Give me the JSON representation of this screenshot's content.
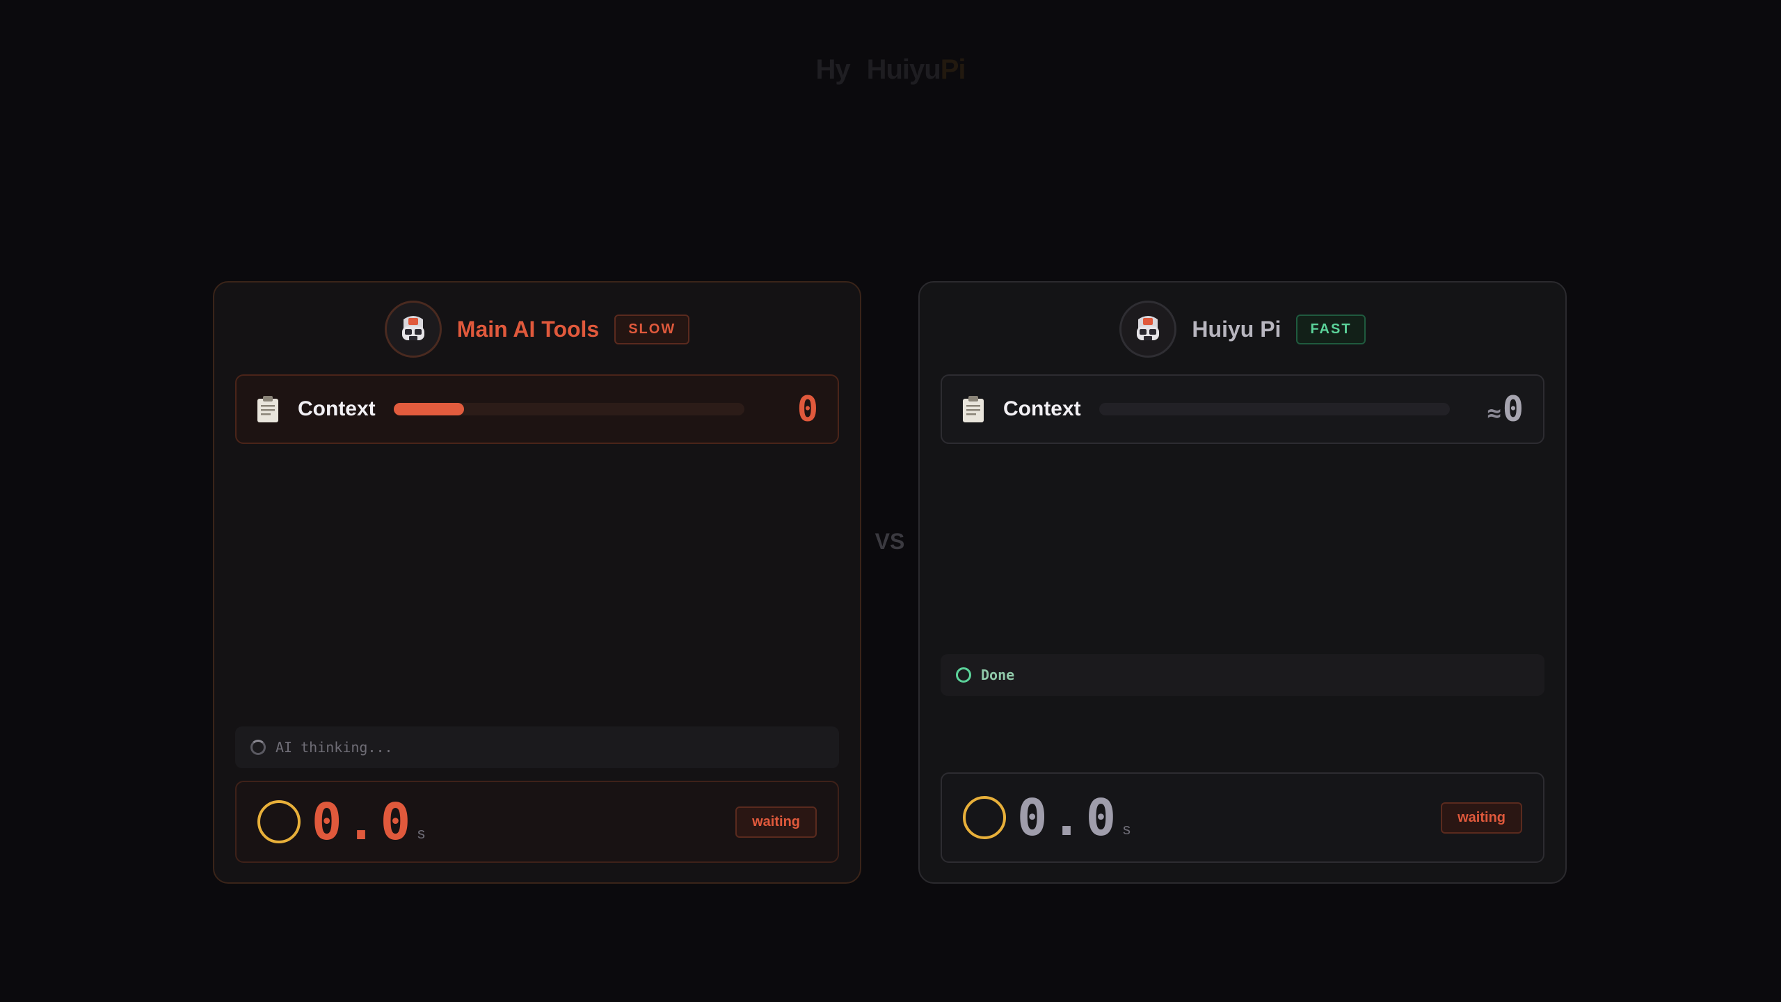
{
  "brand": {
    "mark": "Hy",
    "name_part1": "Huiyu",
    "name_part2": "Pi"
  },
  "vs_label": "VS",
  "left_panel": {
    "title": "Main AI Tools",
    "badge": "SLOW",
    "context_label": "Context",
    "context_progress": 0.2,
    "context_value": "0",
    "status_text": "AI thinking...",
    "timer_value": "0.0",
    "timer_unit": "s",
    "timer_badge": "waiting"
  },
  "right_panel": {
    "title": "Huiyu Pi",
    "badge": "FAST",
    "context_label": "Context",
    "context_progress": 0,
    "context_prefix": "≈",
    "context_value": "0",
    "status_text": "Done",
    "timer_value": "0.0",
    "timer_unit": "s",
    "timer_badge": "waiting"
  },
  "colors": {
    "accent_slow": "#e0593c",
    "accent_fast": "#5bd39a",
    "timer_ring": "#e8b03a",
    "background": "#0b0a0d"
  },
  "icons": {
    "avatar": "robot-avatar-icon",
    "context": "clipboard-icon",
    "status_left": "spinner-icon",
    "status_right": "circle-check-icon",
    "timer": "ring-icon"
  }
}
